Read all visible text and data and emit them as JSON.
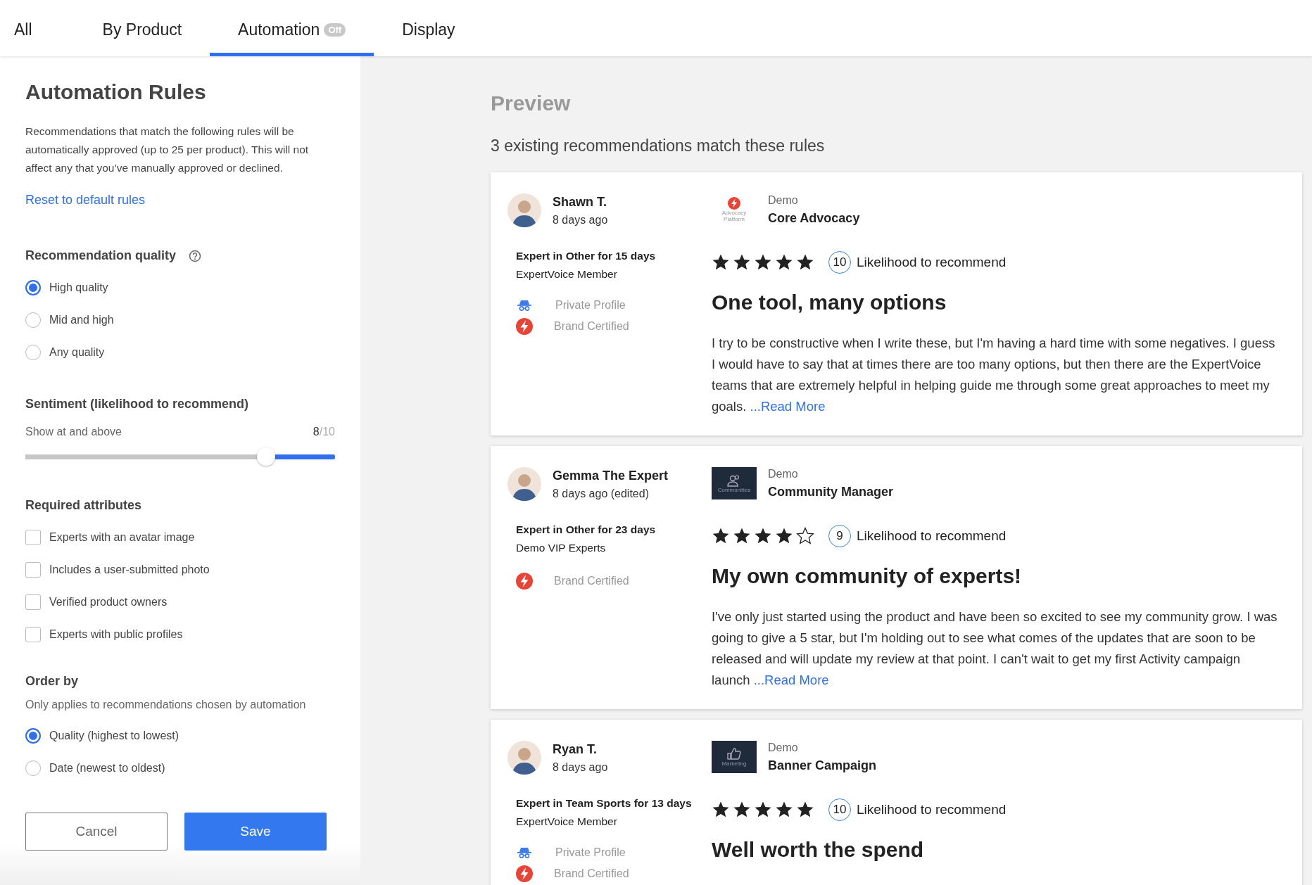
{
  "tabs": [
    {
      "label": "All",
      "selected": false
    },
    {
      "label": "By Product",
      "selected": false
    },
    {
      "label": "Automation",
      "selected": true,
      "badge": "Off"
    },
    {
      "label": "Display",
      "selected": false
    }
  ],
  "rules": {
    "title": "Automation Rules",
    "description": "Recommendations that match the following rules will be automatically approved (up to 25 per product). This will not affect any that you’ve manually approved or declined.",
    "reset_link": "Reset to default rules",
    "quality": {
      "title": "Recommendation quality",
      "options": [
        {
          "label": "High quality",
          "selected": true
        },
        {
          "label": "Mid and high",
          "selected": false
        },
        {
          "label": "Any quality",
          "selected": false
        }
      ]
    },
    "sentiment": {
      "title": "Sentiment (likelihood to recommend)",
      "caption": "Show at and above",
      "value": "8",
      "max": "/10",
      "level": 0.78
    },
    "required_attributes": {
      "title": "Required attributes",
      "options": [
        {
          "label": "Experts with an avatar image",
          "checked": false
        },
        {
          "label": "Includes a user-submitted photo",
          "checked": false
        },
        {
          "label": "Verified product owners",
          "checked": false
        },
        {
          "label": "Experts with public profiles",
          "checked": false
        }
      ]
    },
    "order_by": {
      "title": "Order by",
      "note": "Only applies to recommendations chosen by automation",
      "options": [
        {
          "label": "Quality (highest to lowest)",
          "selected": true
        },
        {
          "label": "Date (newest to oldest)",
          "selected": false
        }
      ]
    },
    "buttons": {
      "cancel": "Cancel",
      "save": "Save"
    }
  },
  "preview": {
    "title": "Preview",
    "summary": "3 existing recommendations match these rules",
    "cards": [
      {
        "name": "Shawn T.",
        "time": "8 days ago",
        "expertise": "Expert in Other for 15 days",
        "group": "ExpertVoice Member",
        "badges": [
          {
            "kind": "private",
            "label": "Private Profile"
          },
          {
            "kind": "certified",
            "label": "Brand Certified"
          }
        ],
        "product": {
          "brand": "Demo",
          "name": "Core Advocacy",
          "logo": {
            "kind": "advocacy",
            "text": "Advocacy Platform"
          }
        },
        "stars": 5,
        "score": "10",
        "score_label": "Likelihood to recommend",
        "title": "One tool, many options",
        "body": "I try to be constructive when I write these, but I'm having a hard time with some negatives. I guess I would have to say that at times there are too many options, but then there are the ExpertVoice teams that are extremely helpful in helping guide me through some great approaches to meet my goals.",
        "read_more": "...Read More"
      },
      {
        "name": "Gemma The Expert",
        "time": "8 days ago (edited)",
        "expertise": "Expert in Other for 23 days",
        "group": "Demo VIP Experts",
        "badges": [
          {
            "kind": "certified",
            "label": "Brand Certified"
          }
        ],
        "product": {
          "brand": "Demo",
          "name": "Community Manager",
          "logo": {
            "kind": "communities",
            "text": "Communities"
          }
        },
        "stars": 4,
        "score": "9",
        "score_label": "Likelihood to recommend",
        "title": "My own community of experts!",
        "body": "I've only just started using the product and have been so excited to see my community grow. I was going to give a 5 star, but I'm holding out to see what comes of the updates that are soon to be released and will update my review at that point. I can't wait to get my first Activity campaign launch",
        "read_more": "...Read More"
      },
      {
        "name": "Ryan T.",
        "time": "8 days ago",
        "expertise": "Expert in Team Sports for 13 days",
        "group": "ExpertVoice Member",
        "badges": [
          {
            "kind": "private",
            "label": "Private Profile"
          },
          {
            "kind": "certified",
            "label": "Brand Certified"
          }
        ],
        "product": {
          "brand": "Demo",
          "name": "Banner Campaign",
          "logo": {
            "kind": "marketing",
            "text": "Marketing"
          }
        },
        "stars": 5,
        "score": "10",
        "score_label": "Likelihood to recommend",
        "title": "Well worth the spend"
      }
    ]
  }
}
